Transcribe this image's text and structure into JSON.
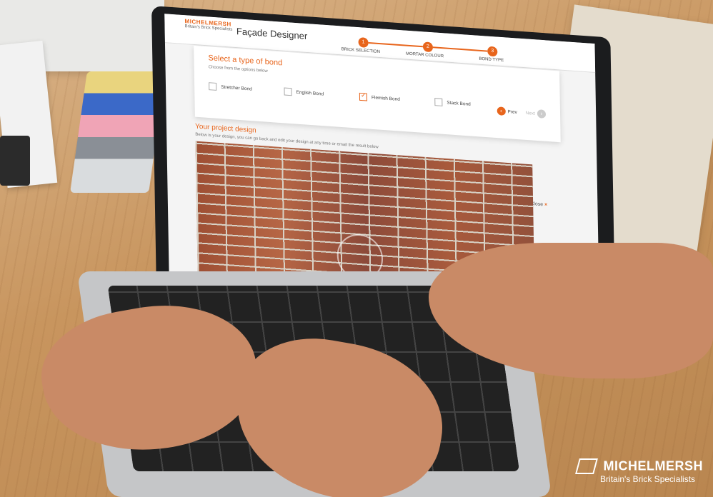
{
  "app": {
    "logo": "MICHELMERSH",
    "logo_tagline": "Britain's Brick Specialists",
    "title": "Façade Designer"
  },
  "steps": [
    {
      "number": "1",
      "label": "BRICK SELECTION"
    },
    {
      "number": "2",
      "label": "MORTAR COLOUR"
    },
    {
      "number": "3",
      "label": "BOND TYPE"
    }
  ],
  "bond_panel": {
    "title": "Select a type of bond",
    "subtitle": "Choose from the options below",
    "options": [
      {
        "label": "Stretcher Bond",
        "checked": false
      },
      {
        "label": "English Bond",
        "checked": false
      },
      {
        "label": "Flemish Bond",
        "checked": true
      },
      {
        "label": "Stack Bond",
        "checked": false
      }
    ],
    "prev_label": "Prev",
    "next_label": "Next"
  },
  "design": {
    "title": "Your project design",
    "subtitle": "Below is your design, you can go back and edit your design at any time or email the result below",
    "close_label": "Close",
    "close_icon": "×"
  },
  "brand": {
    "name": "MICHELMERSH",
    "tagline": "Britain's Brick Specialists"
  },
  "colors": {
    "accent": "#e8651c"
  }
}
